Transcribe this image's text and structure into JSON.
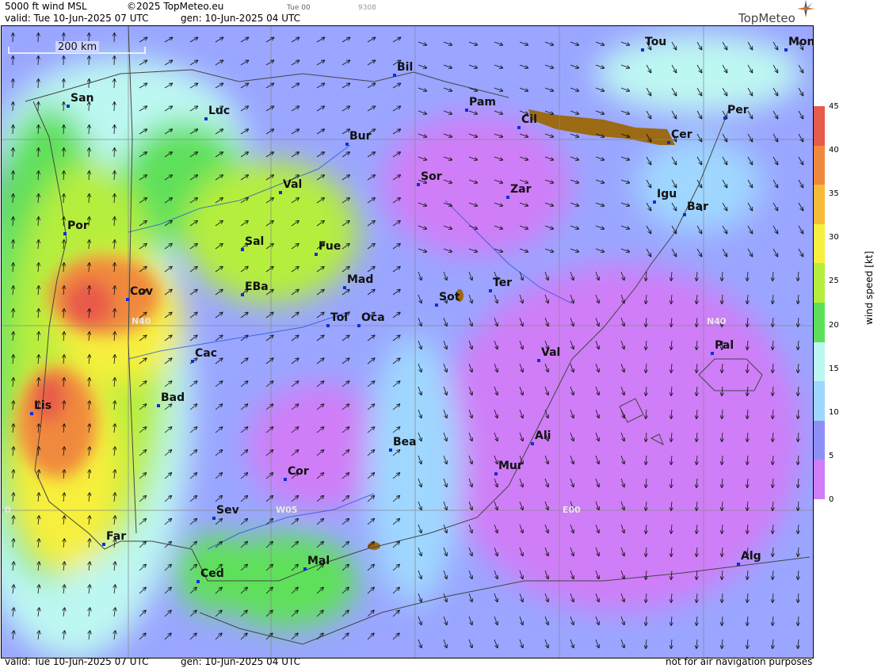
{
  "header": {
    "title": "5000 ft wind MSL",
    "copyright": "©2025 TopMeteo.eu",
    "small_run": "Tue 00",
    "small_id": "9308",
    "valid": "valid:  Tue  10-Jun-2025  07 UTC",
    "gen": "gen: 10-Jun-2025 04 UTC"
  },
  "brand": "TopMeteo",
  "scale": {
    "label": "200 km"
  },
  "grid_labels": {
    "n40_west": "N40",
    "n40_east": "N40",
    "w05": "W05",
    "e00": "E00",
    "w10": "0"
  },
  "cities": [
    {
      "name": "San"
    },
    {
      "name": "Luc"
    },
    {
      "name": "Bil"
    },
    {
      "name": "Pam"
    },
    {
      "name": "Tou"
    },
    {
      "name": "Mon"
    },
    {
      "name": "Cil"
    },
    {
      "name": "Per"
    },
    {
      "name": "Cer"
    },
    {
      "name": "Bur"
    },
    {
      "name": "Sor"
    },
    {
      "name": "Zar"
    },
    {
      "name": "Igu"
    },
    {
      "name": "Bar"
    },
    {
      "name": "Val"
    },
    {
      "name": "Por"
    },
    {
      "name": "Sal"
    },
    {
      "name": "Fue"
    },
    {
      "name": "Mad"
    },
    {
      "name": "EBa"
    },
    {
      "name": "Cov"
    },
    {
      "name": "Sot"
    },
    {
      "name": "Ter"
    },
    {
      "name": "Tol"
    },
    {
      "name": "Oca"
    },
    {
      "name": "Cac"
    },
    {
      "name": "Pal"
    },
    {
      "name": "Val"
    },
    {
      "name": "Bad"
    },
    {
      "name": "Lis"
    },
    {
      "name": "Ali"
    },
    {
      "name": "Bea"
    },
    {
      "name": "Mur"
    },
    {
      "name": "Cor"
    },
    {
      "name": "Sev"
    },
    {
      "name": "Far"
    },
    {
      "name": "Mal"
    },
    {
      "name": "Ced"
    },
    {
      "name": "Alg"
    }
  ],
  "legend": {
    "title": "wind speed [kt]",
    "ticks": [
      "45",
      "40",
      "35",
      "30",
      "25",
      "20",
      "15",
      "10",
      "5",
      "0"
    ],
    "colors": [
      "#e85a4a",
      "#f0893c",
      "#f7bb3a",
      "#f7ef3e",
      "#b6ee3e",
      "#5ee05a",
      "#bdf7f2",
      "#9fd7ff",
      "#8f90f7",
      "#cf7ef7"
    ]
  },
  "footer": {
    "valid": "valid:  Tue  10-Jun-2025  07 UTC",
    "gen": "gen: 10-Jun-2025 04 UTC",
    "disclaimer": "not for air navigation purposes"
  }
}
